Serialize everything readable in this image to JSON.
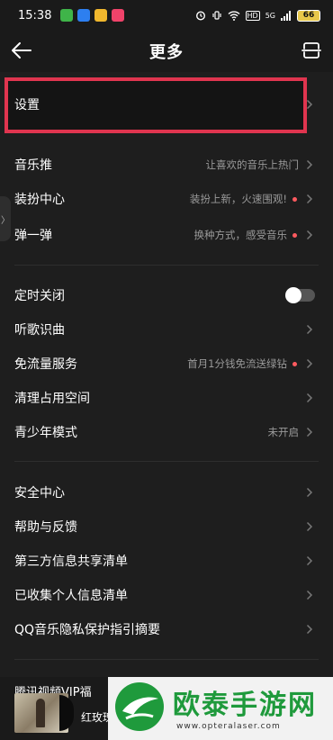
{
  "status_bar": {
    "time": "15:38",
    "network": "5G",
    "hd": "HD",
    "battery": "66",
    "app_icon_colors": [
      "#3fb449",
      "#2d7ff0",
      "#f0b72d",
      "#f0436a"
    ]
  },
  "nav": {
    "title": "更多",
    "back_icon": "arrow-left-icon",
    "scan_icon": "scan-icon"
  },
  "sections": [
    {
      "items": [
        {
          "label": "设置",
          "desc": "",
          "dot": false,
          "control": "chevron"
        }
      ]
    },
    {
      "items": [
        {
          "label": "音乐推",
          "desc": "让喜欢的音乐上热门",
          "dot": false,
          "control": "chevron"
        },
        {
          "label": "装扮中心",
          "desc": "装扮上新，火速围观!",
          "dot": true,
          "control": "chevron"
        },
        {
          "label": "弹一弹",
          "desc": "换种方式，感受音乐",
          "dot": true,
          "control": "chevron"
        }
      ]
    },
    {
      "items": [
        {
          "label": "定时关闭",
          "desc": "",
          "dot": false,
          "control": "toggle",
          "toggle_on": false
        },
        {
          "label": "听歌识曲",
          "desc": "",
          "dot": false,
          "control": "chevron"
        },
        {
          "label": "免流量服务",
          "desc": "首月1分钱免流送绿钻",
          "dot": true,
          "control": "chevron"
        },
        {
          "label": "清理占用空间",
          "desc": "",
          "dot": false,
          "control": "chevron"
        },
        {
          "label": "青少年模式",
          "desc": "未开启",
          "dot": false,
          "control": "chevron"
        }
      ]
    },
    {
      "items": [
        {
          "label": "安全中心",
          "desc": "",
          "dot": false,
          "control": "chevron"
        },
        {
          "label": "帮助与反馈",
          "desc": "",
          "dot": false,
          "control": "chevron"
        },
        {
          "label": "第三方信息共享清单",
          "desc": "",
          "dot": false,
          "control": "chevron"
        },
        {
          "label": "已收集个人信息清单",
          "desc": "",
          "dot": false,
          "control": "chevron"
        },
        {
          "label": "QQ音乐隐私保护指引摘要",
          "desc": "",
          "dot": false,
          "control": "chevron"
        }
      ]
    }
  ],
  "side_tab": "〉",
  "bottom": {
    "promo": "腾讯视频VIP福",
    "song": "红玫瑰"
  },
  "watermark": {
    "text": "欧泰手游网",
    "url": "www.opteralaser.com"
  },
  "colors": {
    "highlight": "#e0354f",
    "dot": "#ff5a5f",
    "watermark_green": "#1f9a3c"
  }
}
